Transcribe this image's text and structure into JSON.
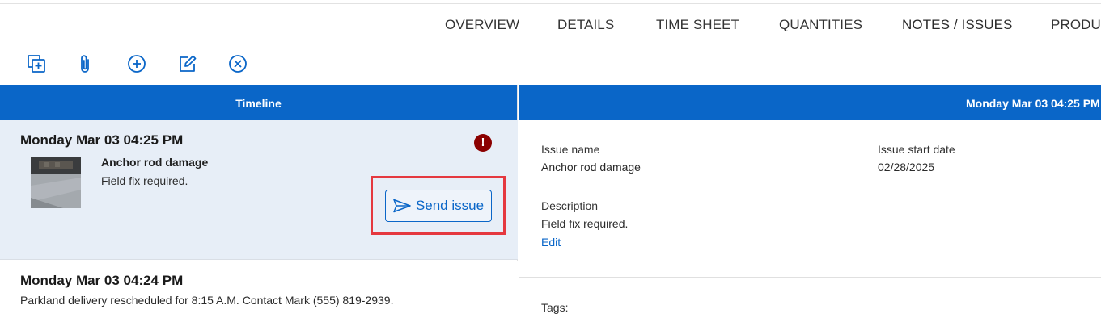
{
  "tabs": [
    {
      "label": "OVERVIEW"
    },
    {
      "label": "DETAILS"
    },
    {
      "label": "TIME SHEET"
    },
    {
      "label": "QUANTITIES"
    },
    {
      "label": "NOTES / ISSUES",
      "active": true
    },
    {
      "label": "PRODUC"
    }
  ],
  "toolbar": {
    "icons": [
      "duplicate-icon",
      "attachment-icon",
      "add-circle-icon",
      "edit-icon",
      "cancel-circle-icon"
    ]
  },
  "timeline": {
    "header": "Timeline",
    "entries": [
      {
        "date": "Monday Mar 03 04:25 PM",
        "title": "Anchor rod damage",
        "body": "Field fix required.",
        "action_label": "Send issue",
        "has_alert": true,
        "alert_glyph": "!"
      },
      {
        "date": "Monday Mar 03 04:24 PM",
        "body": "Parkland delivery rescheduled for 8:15 A.M. Contact Mark (555) 819-2939."
      }
    ]
  },
  "detail": {
    "header": "Monday Mar 03 04:25 PM",
    "issue_name_label": "Issue name",
    "issue_name_value": "Anchor rod damage",
    "issue_start_label": "Issue start date",
    "issue_start_value": "02/28/2025",
    "description_label": "Description",
    "description_value": "Field fix required.",
    "edit_label": "Edit",
    "tags_label": "Tags:"
  },
  "colors": {
    "accent": "#0a66c8",
    "selected_bg": "#e7eef7",
    "alert": "#8b0000",
    "highlight": "#e5383f"
  }
}
